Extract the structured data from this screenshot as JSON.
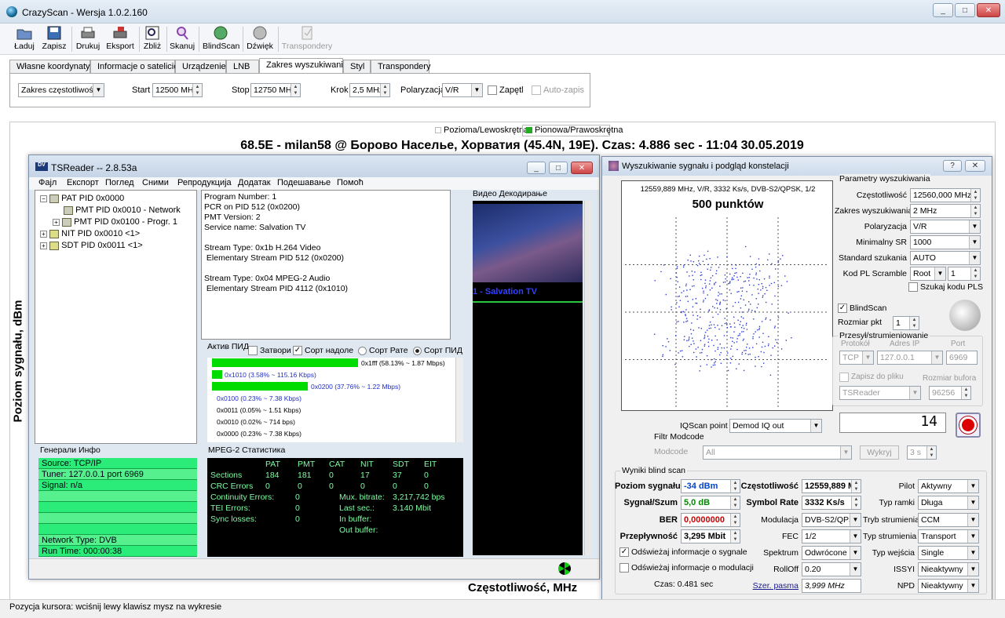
{
  "app": {
    "title": "CrazyScan - Wersja 1.0.2.160"
  },
  "toolbar": [
    "Ładuj",
    "Zapisz",
    "Drukuj",
    "Eksport",
    "Zbliż",
    "Skanuj",
    "BlindScan",
    "Dźwięk",
    "Transpondery"
  ],
  "tabs": [
    "Własne koordynaty",
    "Informacje o satelicie",
    "Urządzenie",
    "LNB",
    "Zakres wyszukiwania",
    "Styl",
    "Transpondery"
  ],
  "search": {
    "range_mode": "Zakres częstotliwości",
    "start_label": "Start",
    "start": "12500 MHz",
    "stop_label": "Stop",
    "stop": "12750 MHz",
    "step_label": "Krok",
    "step": "2,5 MHz",
    "pol_label": "Polaryzacja",
    "pol": "V/R",
    "loop": "Zapętl",
    "autosave": "Auto-zapis"
  },
  "plot": {
    "legend_h": "Pozioma/Lewoskrętna",
    "legend_v": "Pionowa/Prawoskrętna",
    "title": "68.5E - milan58 @ Борово Насельe, Хорватия (45.4N, 19E). Czas: 4.886 sec - 11:04 30.05.2019",
    "ylabel": "Poziom sygnału, dBm",
    "xlabel": "Częstotliwość, MHz",
    "legend_v_color": "#22aa22"
  },
  "status": "Pozycja kursora: wciśnij lewy klawisz mysz na wykresie",
  "tsreader": {
    "title": "TSReader -- 2.8.53a",
    "menu": [
      "Фајл",
      "Експорт",
      "Поглед",
      "Сними",
      "Репродукција",
      "Додатак",
      "Подешавање",
      "Помоћ"
    ],
    "tree": [
      "PAT PID 0x0000",
      "PMT PID 0x0010 - Network",
      "PMT PID 0x0100 - Progr. 1",
      "NIT PID 0x0010 <1>",
      "SDT PID 0x0011 <1>"
    ],
    "info": [
      "Program Number: 1",
      "PCR on PID 512 (0x0200)",
      "PMT Version: 2",
      "Service name: Salvation TV",
      "",
      "Stream Type: 0x1b H.264 Video",
      " Elementary Stream PID 512 (0x0200)",
      "",
      "Stream Type: 0x04 MPEG-2 Audio",
      " Elementary Stream PID 4112 (0x1010)"
    ],
    "video_label": "Видео Декодирање",
    "channel": "1 - Salvation TV",
    "active_label": "Актив ПИД",
    "opts": [
      "Затвори",
      "Сорт надоле",
      "Сорт Рате",
      "Сорт ПИД"
    ],
    "pids": [
      {
        "text": "0x1fff (58.13% ~ 1.87 Mbps)",
        "fill": 0.58,
        "blue": false
      },
      {
        "text": "0x1010 (3.58% ~ 115.16 Kbps)",
        "fill": 0.04,
        "blue": true
      },
      {
        "text": "0x0200 (37.76% ~ 1.22 Mbps)",
        "fill": 0.38,
        "blue": true
      },
      {
        "text": "0x0100 (0.23% ~ 7.38 Kbps)",
        "fill": 0,
        "blue": true
      },
      {
        "text": "0x0011 (0.05% ~ 1.51 Kbps)",
        "fill": 0,
        "blue": false
      },
      {
        "text": "0x0010 (0.02% ~ 714 bps)",
        "fill": 0,
        "blue": false
      },
      {
        "text": "0x0000 (0.23% ~ 7.38 Kbps)",
        "fill": 0,
        "blue": false
      }
    ],
    "general_label": "Генерали Инфо",
    "general": [
      "Source: TCP/IP",
      "Tuner: 127.0.0.1 port 6969",
      "Signal: n/a",
      "",
      "",
      "",
      "",
      "Network Type: DVB",
      "Run Time: 000:00:38"
    ],
    "mpeg_label": "MPEG-2 Статистика",
    "mpeg_head": [
      "PAT",
      "PMT",
      "CAT",
      "NIT",
      "SDT",
      "EIT"
    ],
    "sections": [
      "Sections",
      "184",
      "181",
      "0",
      "17",
      "37",
      "0"
    ],
    "crc": [
      "CRC Errors",
      "0",
      "0",
      "0",
      "0",
      "0",
      "0"
    ],
    "stats_left": [
      [
        "Continuity Errors:",
        "0"
      ],
      [
        "TEI Errors:",
        "0"
      ],
      [
        "Sync losses:",
        "0"
      ]
    ],
    "stats_right": [
      [
        "Mux. bitrate:",
        "3,217,742 bps"
      ],
      [
        "Last sec.:",
        "3.140 Mbit"
      ],
      [
        "In buffer:",
        ""
      ],
      [
        "Out buffer:",
        ""
      ]
    ]
  },
  "blind": {
    "title": "Wyszukiwanie sygnału i podgląd konstelacji",
    "const_head": "12559,889 MHz, V/R, 3332 Ks/s, DVB-S2/QPSK, 1/2",
    "points": "500 punktów",
    "params_label": "Parametry wyszukiwania",
    "params": [
      [
        "Częstotliwość",
        "12560,000 MHz"
      ],
      [
        "Zakres wyszukiwania",
        "2 MHz"
      ],
      [
        "Polaryzacja",
        "V/R"
      ],
      [
        "Minimalny SR",
        "1000"
      ],
      [
        "Standard szukania",
        "AUTO"
      ],
      [
        "Kod PL Scramble",
        "Root",
        "1"
      ]
    ],
    "pls": "Szukaj kodu PLS",
    "blindscan": "BlindScan",
    "pkt_label": "Rozmiar pkt",
    "pkt": "1",
    "stream_label": "Przesył/strumieniowanie",
    "proto": "Protokół",
    "addr": "Adres IP",
    "port": "Port",
    "proto_v": "TCP",
    "addr_v": "127.0.0.1",
    "port_v": "6969",
    "save_file": "Zapisz do pliku",
    "buf_label": "Rozmiar bufora",
    "app_v": "TSReader",
    "buf_v": "96256",
    "iq_label": "IQScan point",
    "iq": "Demod IQ out",
    "counter": "14",
    "filter_label": "Filtr Modcode",
    "modcode": "Modcode",
    "modcode_v": "All",
    "exclude": "Wykryj",
    "secs": "3 s",
    "results_label": "Wyniki blind scan",
    "level_label": "Poziom sygnału",
    "level": "-34 dBm",
    "snr_label": "Sygnał/Szum",
    "snr": "5,0 dB",
    "ber_label": "BER",
    "ber": "0,0000000",
    "rate_label": "Przepływność",
    "rate": "3,295 Mbit",
    "freq_label": "Częstotliwość",
    "freq": "12559,889 M",
    "sr_label": "Symbol Rate",
    "sr": "3332 Ks/s",
    "mod_label": "Modulacja",
    "mod": "DVB-S2/QPSK",
    "fec_label": "FEC",
    "fec": "1/2",
    "spec_label": "Spektrum",
    "spec": "Odwrócone",
    "roll_label": "RollOff",
    "roll": "0.20",
    "bw_label": "Szer. pasma",
    "bw": "3,999 MHz",
    "pilot_label": "Pilot",
    "pilot": "Aktywny",
    "frame_label": "Typ ramki",
    "frame": "Długa",
    "smode_label": "Tryb strumienia",
    "smode": "CCM",
    "stype_label": "Typ strumienia",
    "stype": "Transport",
    "input_label": "Typ wejścia",
    "input": "Single",
    "issy_label": "ISSYI",
    "issy": "Nieaktywny",
    "npd_label": "NPD",
    "npd": "Nieaktywny",
    "refresh_sig": "Odświeżaj informacje o sygnale",
    "refresh_mod": "Odświeżaj informacje o modulacji",
    "time": "Czas: 0.481 sec",
    "level_color": "#0044cc",
    "snr_color": "#008800",
    "ber_color": "#cc0000"
  }
}
